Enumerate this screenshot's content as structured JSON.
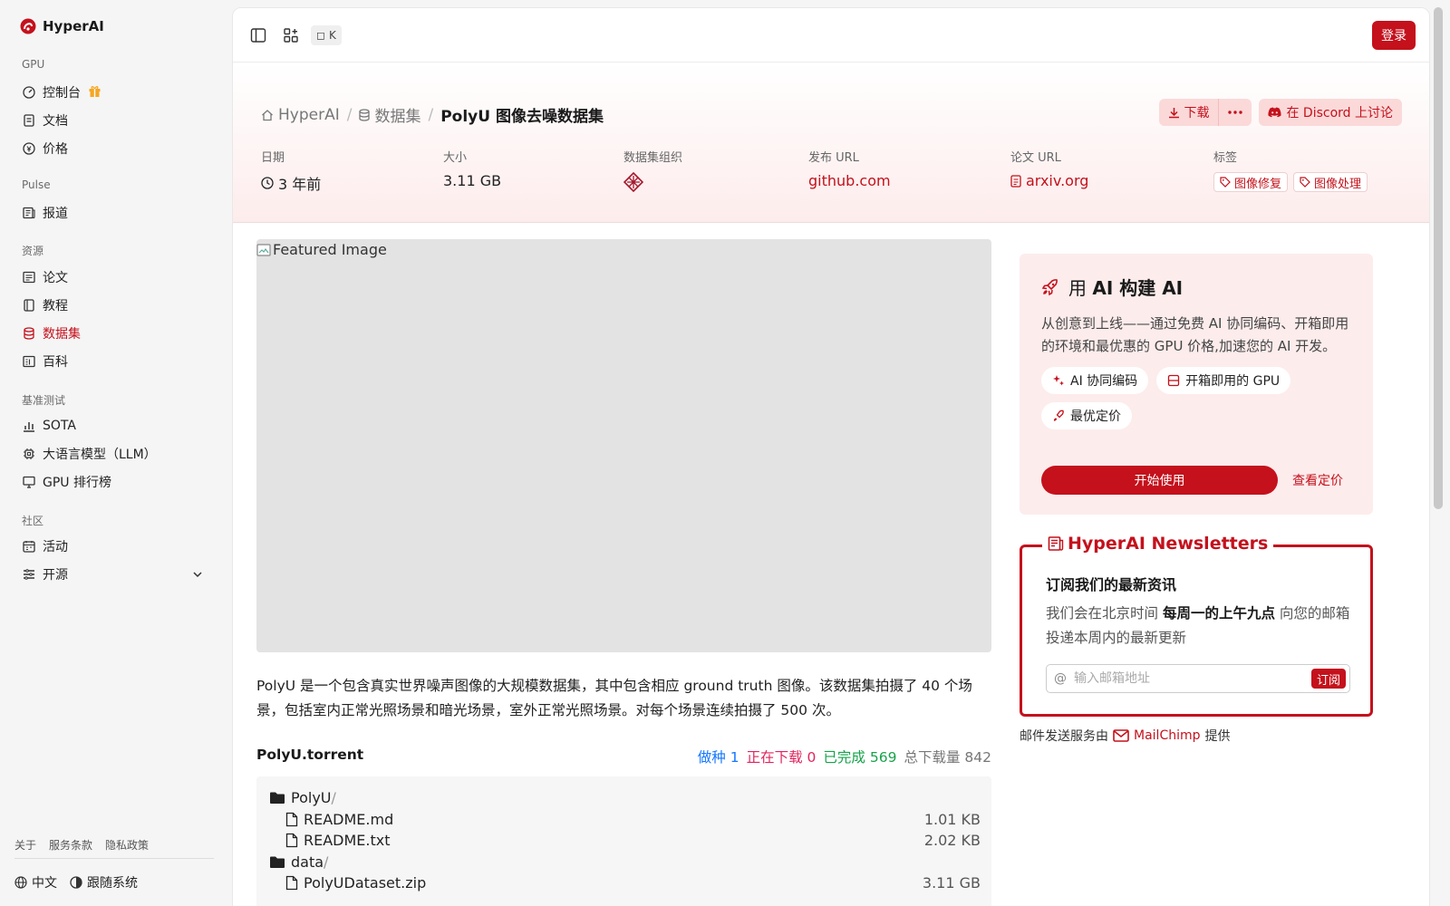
{
  "brand": {
    "name": "HyperAI"
  },
  "sidebar": {
    "sections": [
      {
        "title": "GPU",
        "items": [
          {
            "label": "控制台",
            "icon": "gauge-icon",
            "badge": "gift-icon"
          },
          {
            "label": "文档",
            "icon": "doc-icon"
          },
          {
            "label": "价格",
            "icon": "price-icon"
          }
        ]
      },
      {
        "title": "Pulse",
        "items": [
          {
            "label": "报道",
            "icon": "news-icon"
          }
        ]
      },
      {
        "title": "资源",
        "items": [
          {
            "label": "论文",
            "icon": "paper-icon"
          },
          {
            "label": "教程",
            "icon": "book-icon"
          },
          {
            "label": "数据集",
            "icon": "database-icon",
            "active": true
          },
          {
            "label": "百科",
            "icon": "wiki-icon"
          }
        ]
      },
      {
        "title": "基准测试",
        "items": [
          {
            "label": "SOTA",
            "icon": "chart-icon"
          },
          {
            "label": "大语言模型（LLM）",
            "icon": "chip-icon"
          },
          {
            "label": "GPU 排行榜",
            "icon": "monitor-icon"
          }
        ]
      },
      {
        "title": "社区",
        "items": [
          {
            "label": "活动",
            "icon": "event-icon"
          },
          {
            "label": "开源",
            "icon": "list-icon",
            "expandable": true
          }
        ]
      }
    ],
    "footer_links": [
      "关于",
      "服务条款",
      "隐私政策"
    ],
    "language": "中文",
    "theme": "跟随系统"
  },
  "topbar": {
    "shortcut": "K",
    "login": "登录"
  },
  "breadcrumb": {
    "home": "HyperAI",
    "section": "数据集",
    "current": "PolyU 图像去噪数据集"
  },
  "actions": {
    "download": "下载",
    "discord": "在 Discord 上讨论"
  },
  "meta": {
    "date": {
      "label": "日期",
      "value": "3 年前"
    },
    "size": {
      "label": "大小",
      "value": "3.11 GB"
    },
    "org": {
      "label": "数据集组织"
    },
    "publish_url": {
      "label": "发布 URL",
      "value": "github.com"
    },
    "paper_url": {
      "label": "论文 URL",
      "value": "arxiv.org"
    },
    "tags": {
      "label": "标签",
      "values": [
        "图像修复",
        "图像处理"
      ]
    }
  },
  "featured_alt": "Featured Image",
  "description": "PolyU 是一个包含真实世界噪声图像的大规模数据集，其中包含相应 ground truth 图像。该数据集拍摄了 40 个场景，包括室内正常光照场景和暗光场景，室外正常光照场景。对每个场景连续拍摄了 500 次。",
  "torrent": {
    "name": "PolyU.torrent",
    "seeding_label": "做种",
    "seeding": "1",
    "downloading_label": "正在下载",
    "downloading": "0",
    "completed_label": "已完成",
    "completed": "569",
    "total_label": "总下载量",
    "total": "842",
    "files": [
      {
        "type": "folder",
        "name": "PolyU",
        "size": "",
        "depth": 0
      },
      {
        "type": "file",
        "name": "README.md",
        "size": "1.01 KB",
        "depth": 1
      },
      {
        "type": "file",
        "name": "README.txt",
        "size": "2.02 KB",
        "depth": 1
      },
      {
        "type": "folder",
        "name": "data",
        "size": "",
        "depth": 0
      },
      {
        "type": "file",
        "name": "PolyUDataset.zip",
        "size": "3.11 GB",
        "depth": 1
      }
    ]
  },
  "promo": {
    "title_prefix": "用",
    "title_bold": "AI 构建 AI",
    "body": "从创意到上线——通过免费 AI 协同编码、开箱即用的环境和最优惠的 GPU 价格,加速您的 AI 开发。",
    "chips": [
      "AI 协同编码",
      "开箱即用的 GPU",
      "最优定价"
    ],
    "start": "开始使用",
    "pricing": "查看定价"
  },
  "newsletter": {
    "title": "HyperAI Newsletters",
    "subtitle": "订阅我们的最新资讯",
    "body_prefix": "我们会在北京时间",
    "body_bold": "每周一的上午九点",
    "body_suffix": "向您的邮箱投递本周内的最新更新",
    "placeholder": "输入邮箱地址",
    "subscribe": "订阅",
    "provider_prefix": "邮件发送服务由",
    "provider": "MailChimp",
    "provider_suffix": "提供"
  },
  "colors": {
    "accent": "#c4111c",
    "seeding": "#1677ff",
    "downloading": "#e0245e",
    "completed": "#16a34a"
  }
}
